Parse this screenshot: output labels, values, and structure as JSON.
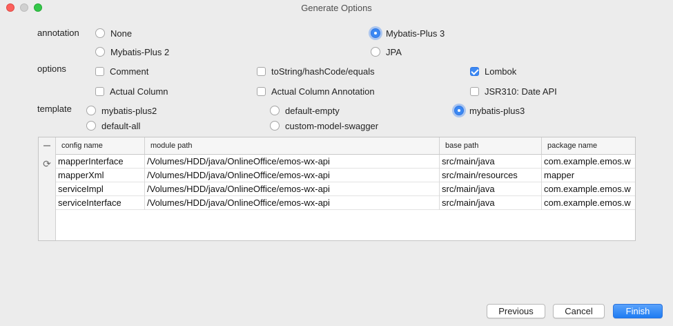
{
  "window": {
    "title": "Generate Options"
  },
  "annotation": {
    "label": "annotation",
    "options": [
      {
        "label": "None",
        "selected": false
      },
      {
        "label": "Mybatis-Plus 3",
        "selected": true
      },
      {
        "label": "Mybatis-Plus 2",
        "selected": false
      },
      {
        "label": "JPA",
        "selected": false
      }
    ]
  },
  "options": {
    "label": "options",
    "items": [
      {
        "label": "Comment",
        "checked": false
      },
      {
        "label": "toString/hashCode/equals",
        "checked": false
      },
      {
        "label": "Lombok",
        "checked": true
      },
      {
        "label": "Actual Column",
        "checked": false
      },
      {
        "label": "Actual Column Annotation",
        "checked": false
      },
      {
        "label": "JSR310: Date API",
        "checked": false
      }
    ]
  },
  "template": {
    "label": "template",
    "options": [
      {
        "label": "mybatis-plus2",
        "selected": false
      },
      {
        "label": "default-empty",
        "selected": false
      },
      {
        "label": "mybatis-plus3",
        "selected": true
      },
      {
        "label": "default-all",
        "selected": false
      },
      {
        "label": "custom-model-swagger",
        "selected": false
      }
    ]
  },
  "table": {
    "columns": [
      "config name",
      "module path",
      "base path",
      "package name"
    ],
    "rows": [
      [
        "mapperInterface",
        "/Volumes/HDD/java/OnlineOffice/emos-wx-api",
        "src/main/java",
        "com.example.emos.w"
      ],
      [
        "mapperXml",
        "/Volumes/HDD/java/OnlineOffice/emos-wx-api",
        "src/main/resources",
        "mapper"
      ],
      [
        "serviceImpl",
        "/Volumes/HDD/java/OnlineOffice/emos-wx-api",
        "src/main/java",
        "com.example.emos.w"
      ],
      [
        "serviceInterface",
        "/Volumes/HDD/java/OnlineOffice/emos-wx-api",
        "src/main/java",
        "com.example.emos.w"
      ]
    ],
    "tools": {
      "remove_icon": "minus-icon",
      "refresh_icon": "refresh-icon"
    }
  },
  "buttons": {
    "previous": "Previous",
    "cancel": "Cancel",
    "finish": "Finish"
  },
  "colors": {
    "accent": "#3c88f2",
    "background": "#ececec"
  }
}
